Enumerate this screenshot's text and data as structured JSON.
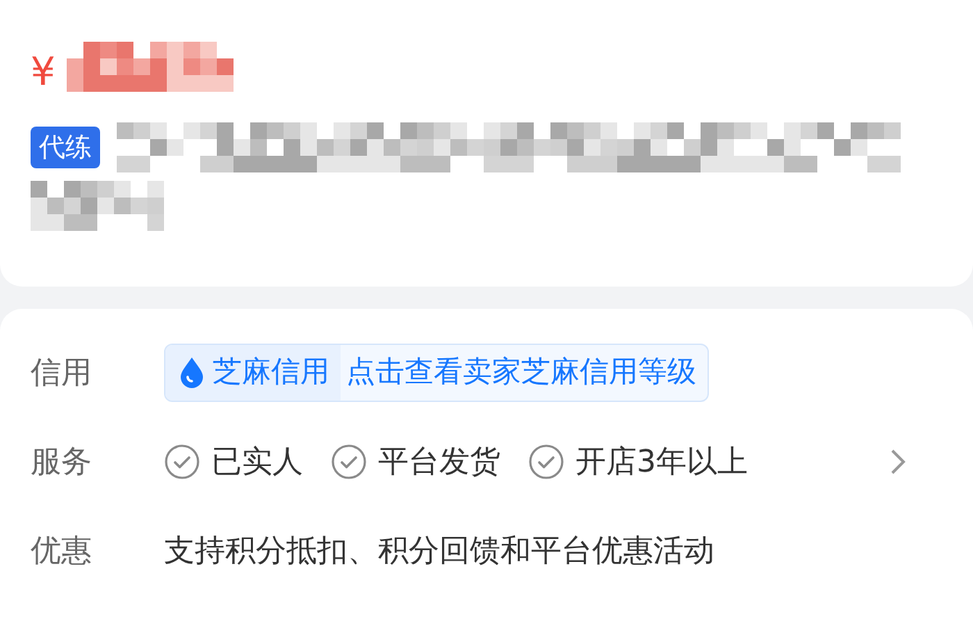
{
  "listing": {
    "currency": "¥",
    "tag": "代练"
  },
  "details": [
    {
      "label": "信用",
      "kind": "credit",
      "brand": "芝麻信用",
      "link": "点击查看卖家芝麻信用等级"
    },
    {
      "label": "服务",
      "kind": "services",
      "items": [
        "已实人",
        "平台发货",
        "开店3年以上"
      ]
    },
    {
      "label": "优惠",
      "kind": "text",
      "text": "支持积分抵扣、积分回馈和平台优惠活动"
    }
  ]
}
